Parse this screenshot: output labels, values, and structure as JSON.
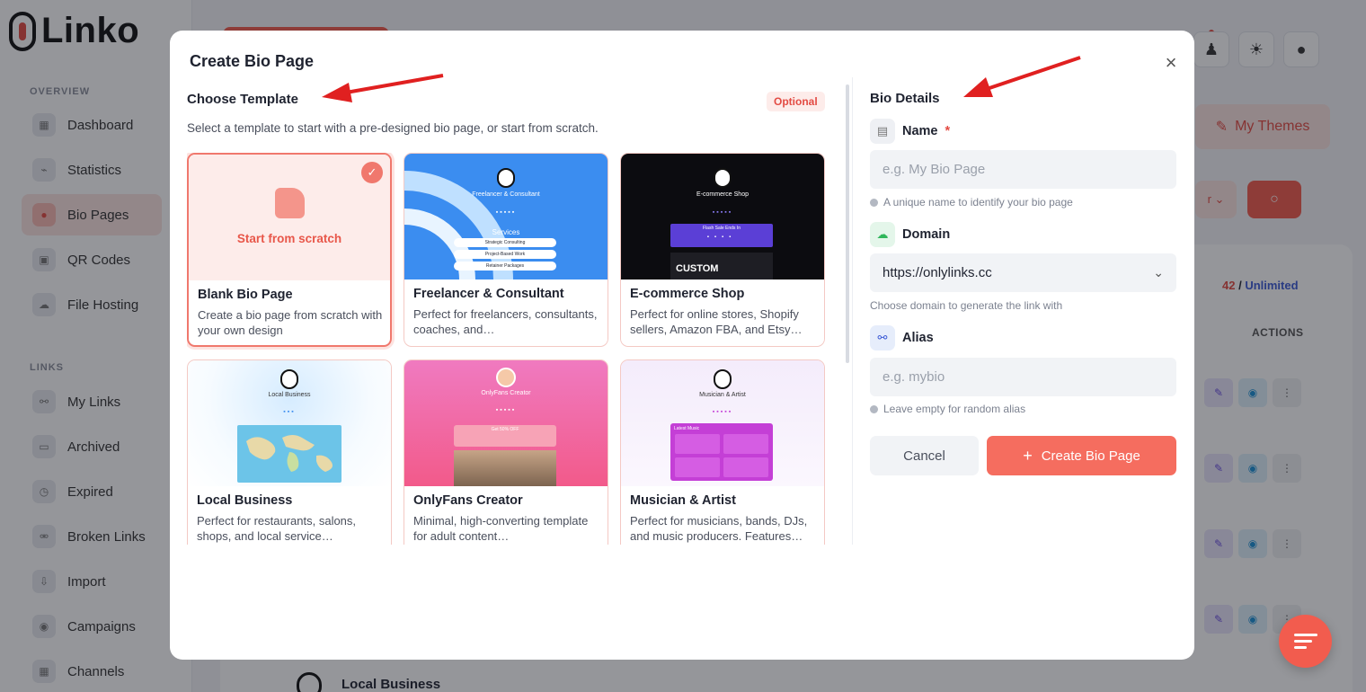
{
  "app": {
    "logo_text": "Linko",
    "sidebar": {
      "overview_label": "OVERVIEW",
      "links_label": "LINKS",
      "items": [
        {
          "label": "Dashboard",
          "icon": "dashboard-icon"
        },
        {
          "label": "Statistics",
          "icon": "chart-icon"
        },
        {
          "label": "Bio Pages",
          "icon": "users-icon",
          "active": true
        },
        {
          "label": "QR Codes",
          "icon": "qr-icon"
        },
        {
          "label": "File Hosting",
          "icon": "cloud-icon"
        },
        {
          "label": "My Links",
          "icon": "link-icon"
        },
        {
          "label": "Archived",
          "icon": "archive-icon"
        },
        {
          "label": "Expired",
          "icon": "clock-icon"
        },
        {
          "label": "Broken Links",
          "icon": "broken-link-icon"
        },
        {
          "label": "Import",
          "icon": "import-icon"
        },
        {
          "label": "Campaigns",
          "icon": "target-icon"
        },
        {
          "label": "Channels",
          "icon": "grid-icon"
        }
      ]
    },
    "header": {
      "my_themes_label": "My Themes",
      "filter_label": "r ⌄"
    },
    "list": {
      "count_used": "42",
      "count_sep": " / ",
      "count_limit": "Unlimited",
      "actions_header": "ACTIONS",
      "last_row_title": "Local Business"
    }
  },
  "modal": {
    "title": "Create Bio Page",
    "close_label": "×",
    "template_section": {
      "title": "Choose Template",
      "badge": "Optional",
      "description": "Select a template to start with a pre-designed bio page, or start from scratch.",
      "templates": [
        {
          "name": "Blank Bio Page",
          "description": "Create a bio page from scratch with your own design",
          "thumb_label": "Start from scratch",
          "selected": true
        },
        {
          "name": "Freelancer & Consultant",
          "description": "Perfect for freelancers, consultants, coaches, and…",
          "thumb_title": "Freelancer & Consultant",
          "thumb_section": "Services",
          "thumb_buttons": [
            "Strategic Consulting",
            "Project-Based Work",
            "Retainer Packages"
          ]
        },
        {
          "name": "E-commerce Shop",
          "description": "Perfect for online stores, Shopify sellers, Amazon FBA, and Etsy…",
          "thumb_title": "E-commerce Shop",
          "thumb_banner": "Flash Sale Ends In",
          "thumb_timer": [
            "00",
            "00",
            "00",
            "00"
          ],
          "thumb_promo": "CUSTOM"
        },
        {
          "name": "Local Business",
          "description": "Perfect for restaurants, salons, shops, and local service…",
          "thumb_title": "Local Business"
        },
        {
          "name": "OnlyFans Creator",
          "description": "Minimal, high-converting template for adult content…",
          "thumb_title": "OnlyFans Creator",
          "thumb_promo": "Get 50% OFF"
        },
        {
          "name": "Musician & Artist",
          "description": "Perfect for musicians, bands, DJs, and music producers. Features…",
          "thumb_title": "Musician & Artist",
          "thumb_section": "Latest Music"
        }
      ]
    },
    "details_section": {
      "title": "Bio Details",
      "name_label": "Name",
      "required_mark": "*",
      "name_placeholder": "e.g. My Bio Page",
      "name_hint": "A unique name to identify your bio page",
      "domain_label": "Domain",
      "domain_value": "https://onlylinks.cc",
      "domain_hint": "Choose domain to generate the link with",
      "alias_label": "Alias",
      "alias_placeholder": "e.g. mybio",
      "alias_hint": "Leave empty for random alias",
      "cancel_label": "Cancel",
      "create_label": "Create Bio Page",
      "create_icon": "+"
    }
  },
  "colors": {
    "accent": "#f56d5f",
    "brand_red": "#e34b43",
    "annotation_arrow": "#e02020"
  }
}
